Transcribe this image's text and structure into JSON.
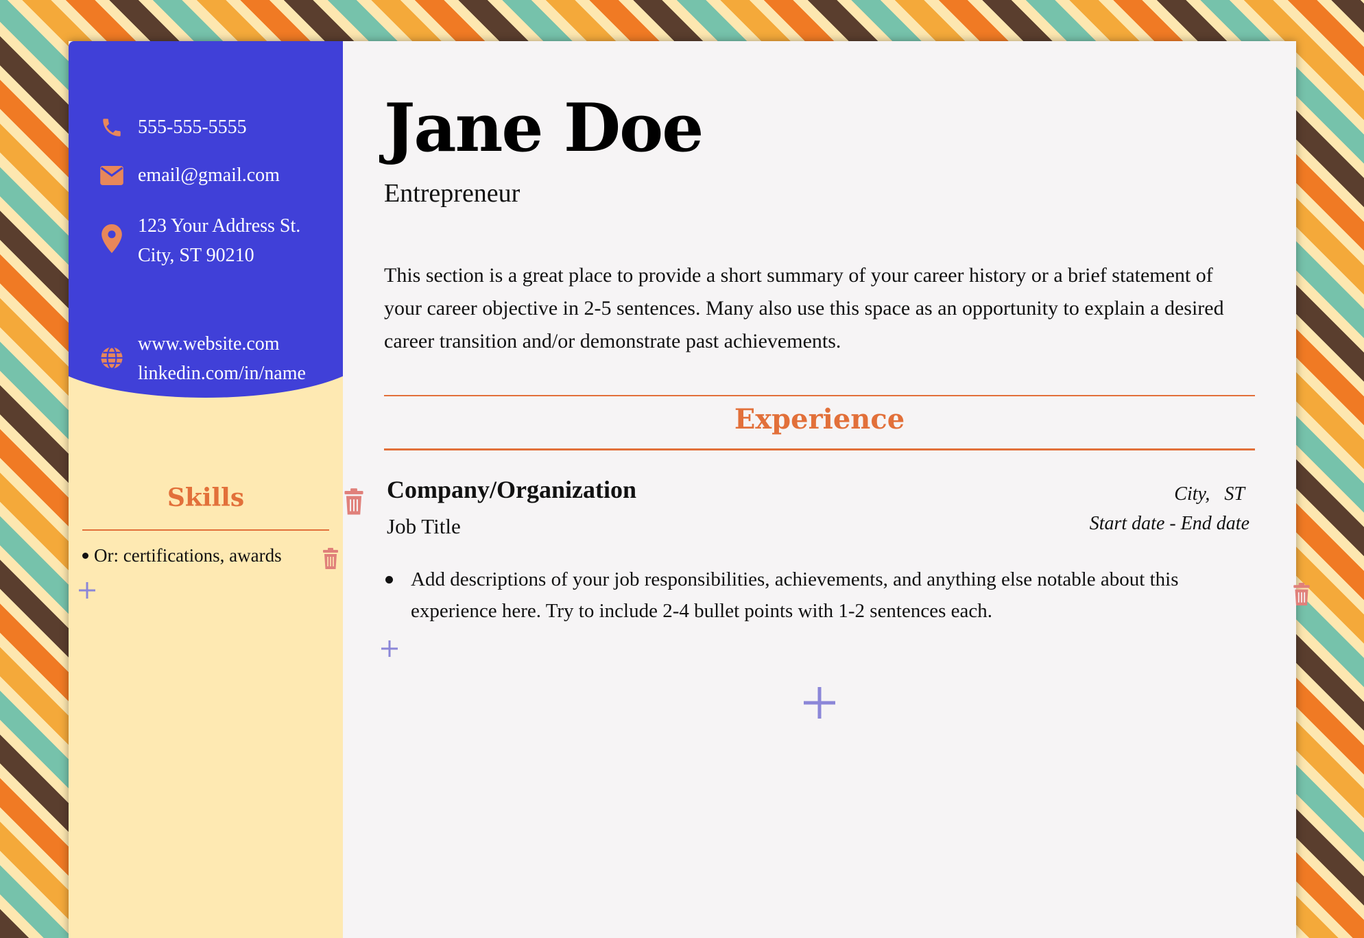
{
  "contact": {
    "phone": "555-555-5555",
    "email": "email@gmail.com",
    "address_line1": "123 Your Address St.",
    "address_line2": "City, ST 90210",
    "website": "www.website.com",
    "linkedin": "linkedin.com/in/name"
  },
  "skills": {
    "title": "Skills",
    "items": [
      "Or: certifications, awards"
    ]
  },
  "header": {
    "name": "Jane Doe",
    "title": "Entrepreneur"
  },
  "summary": "This section is a great place to provide a short summary of your career history or a brief statement of your career objective in 2-5 sentences. Many also use this space as an opportunity to explain a desired career transition and/or demonstrate past achievements.",
  "experience": {
    "title": "Experience",
    "entries": [
      {
        "company": "Company/Organization",
        "job_title": "Job Title",
        "location": "City,   ST",
        "dates": "Start date - End date",
        "bullets": [
          "Add descriptions of your job responsibilities, achievements, and anything else notable about this experience here. Try to include 2-4 bullet points with 1-2 sentences each."
        ]
      }
    ]
  },
  "icons": {
    "contact_icons": [
      "phone-icon",
      "mail-icon",
      "map-pin-icon",
      "globe-icon"
    ],
    "actions": [
      "trash-icon",
      "plus-icon"
    ]
  },
  "colors": {
    "sidebar_blue": "#4040d8",
    "sidebar_cream": "#fee9b2",
    "accent_orange": "#e2703a",
    "icon_orange": "#e8875a",
    "trash_red": "#e0807a",
    "plus_purple": "#8b86d8",
    "page_bg": "#f6f4f5"
  }
}
